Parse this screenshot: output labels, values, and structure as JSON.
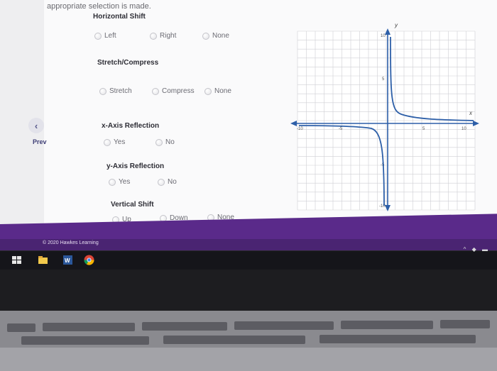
{
  "instruction_tail": "appropriate selection is made.",
  "groups": {
    "horizontal_shift": {
      "title": "Horizontal Shift",
      "options": [
        "Left",
        "Right",
        "None"
      ]
    },
    "stretch_compress": {
      "title": "Stretch/Compress",
      "options": [
        "Stretch",
        "Compress",
        "None"
      ]
    },
    "x_reflection": {
      "title": "x-Axis Reflection",
      "options": [
        "Yes",
        "No"
      ]
    },
    "y_reflection": {
      "title": "y-Axis Reflection",
      "options": [
        "Yes",
        "No"
      ]
    },
    "vertical_shift": {
      "title": "Vertical Shift",
      "options": [
        "Up",
        "Down",
        "None"
      ]
    }
  },
  "nav": {
    "prev_label": "Prev",
    "prev_icon": "chevron-left-icon"
  },
  "graph": {
    "x_axis_label": "x",
    "y_axis_label": "y",
    "x_ticks": [
      "-10",
      "-5",
      "5",
      "10"
    ],
    "y_ticks": [
      "10",
      "5",
      "-5",
      "-10"
    ],
    "x_range": [
      -10,
      10
    ],
    "y_range": [
      -10,
      10
    ],
    "curve_color": "#2d5fa8",
    "axis_color": "#2d5fa8"
  },
  "footer": {
    "copyright": "© 2020 Hawkes Learning",
    "bar_color": "#5a2a8a"
  },
  "taskbar": {
    "icons": [
      "windows-icon",
      "file-explorer-icon",
      "word-icon",
      "chrome-icon"
    ],
    "tray": "^ ◆ ▬"
  }
}
